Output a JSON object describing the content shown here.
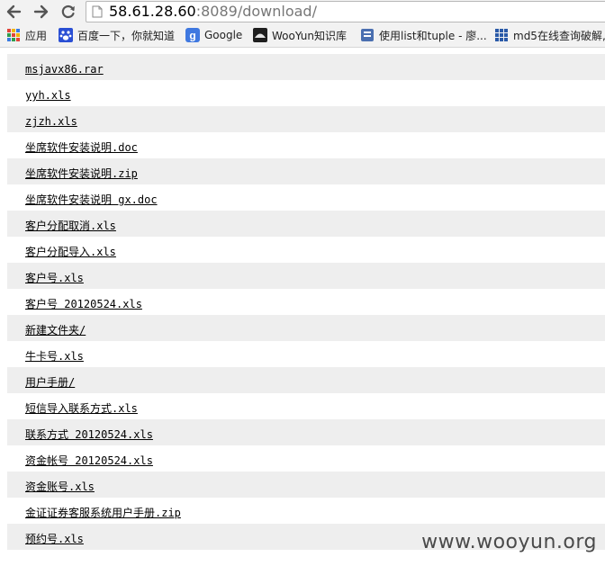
{
  "browser": {
    "url_host": "58.61.28.60",
    "url_rest": ":8089/download/"
  },
  "bookmarks": [
    {
      "label": "应用",
      "icon": "apps-grid-icon"
    },
    {
      "label": "百度一下，你就知道",
      "icon": "baidu-paw-icon"
    },
    {
      "label": "Google",
      "icon": "google-icon"
    },
    {
      "label": "WooYun知识库",
      "icon": "wooyun-icon"
    },
    {
      "label": "使用list和tuple - 廖...",
      "icon": "page-icon"
    },
    {
      "label": "md5在线查询破解,",
      "icon": "md5-icon"
    }
  ],
  "files": [
    "msjavx86.rar",
    "yyh.xls",
    "zjzh.xls",
    "坐席软件安装说明.doc",
    "坐席软件安装说明.zip",
    "坐席软件安装说明 gx.doc",
    "客户分配取消.xls",
    "客户分配导入.xls",
    "客户号.xls",
    "客户号 20120524.xls",
    "新建文件夹/",
    "牛卡号.xls",
    "用户手册/",
    "短信导入联系方式.xls",
    "联系方式 20120524.xls",
    "资金帐号 20120524.xls",
    "资金账号.xls",
    "金证证券客服系统用户手册.zip",
    "预约号.xls"
  ],
  "watermark": "www.wooyun.org"
}
